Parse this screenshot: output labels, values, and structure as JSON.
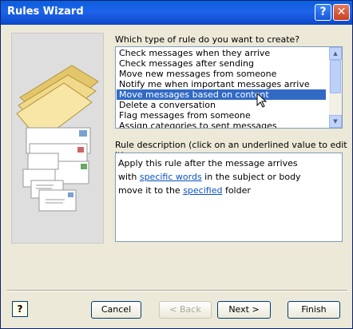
{
  "window": {
    "title": "Rules Wizard"
  },
  "rule_type": {
    "label": "Which type of rule do you want to create?",
    "options": [
      "Check messages when they arrive",
      "Check messages after sending",
      "Move new messages from someone",
      "Notify me when important messages arrive",
      "Move messages based on content",
      "Delete a conversation",
      "Flag messages from someone",
      "Assign categories to sent messages"
    ],
    "selected_index": 4
  },
  "description": {
    "label": "Rule description (click on an underlined value to edit it):",
    "line1": "Apply this rule after the message arrives",
    "line2_prefix": "with ",
    "line2_link": "specific words",
    "line2_suffix": " in the subject or body",
    "line3_prefix": "move it to the ",
    "line3_link": "specified",
    "line3_suffix": " folder"
  },
  "buttons": {
    "cancel": "Cancel",
    "back": "< Back",
    "next": "Next >",
    "finish": "Finish"
  },
  "help_icon": "help-icon"
}
